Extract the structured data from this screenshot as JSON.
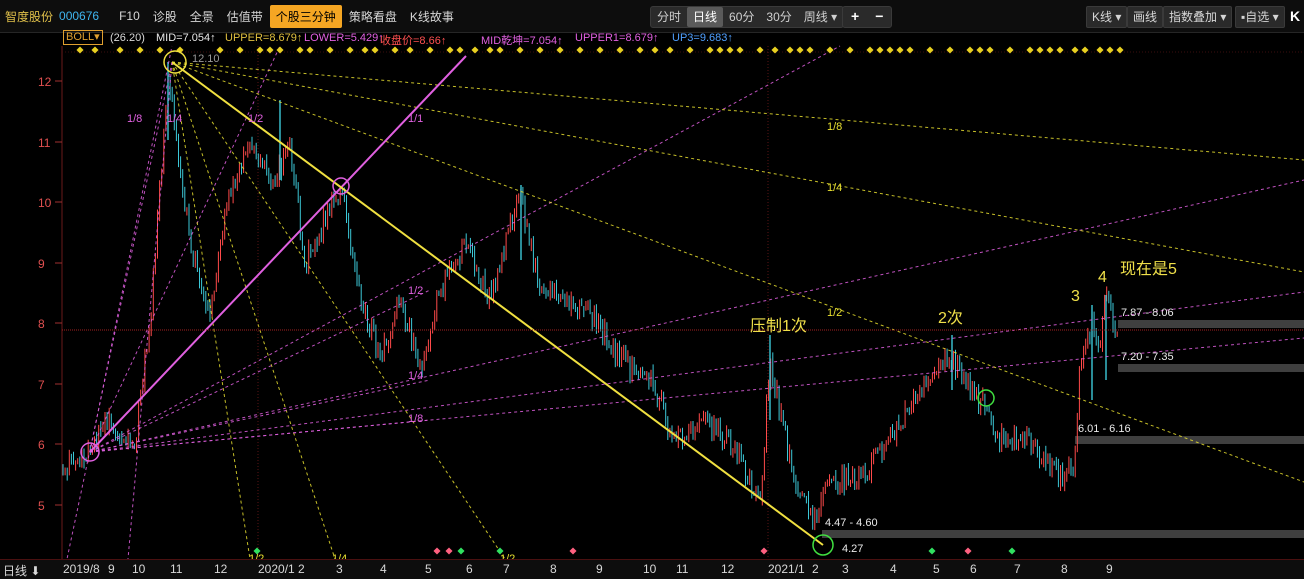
{
  "header": {
    "stock_name": "智度股份",
    "stock_code": "000676",
    "menu": [
      "F10",
      "诊股",
      "全景",
      "估值带",
      "个股三分钟",
      "策略看盘",
      "K线故事"
    ],
    "active_menu": "个股三分钟",
    "periods": [
      "分时",
      "日线",
      "60分",
      "30分",
      "周线 ▾"
    ],
    "active_period": "日线",
    "zoom_in": "+",
    "zoom_out": "−",
    "right_buttons": [
      "K线 ▾",
      "画线",
      "指数叠加 ▾",
      "▪自选 ▾"
    ],
    "right_edge": "K"
  },
  "indicator": {
    "name": "BOLL▾",
    "params": "(26.20)",
    "mid": "MID=7.054↑",
    "upper": "UPPER=8.679↑",
    "lower": "LOWER=5.429↑",
    "close": "收盘价=8.66↑",
    "mid2": "MID乾坤=7.054↑",
    "upper1": "UPPER1=8.679↑",
    "up3": "UP3=9.683↑"
  },
  "y_axis": [
    "12",
    "11",
    "10",
    "9",
    "8",
    "7",
    "6",
    "5"
  ],
  "x_axis": {
    "period_label": "日线 ⬇",
    "labels": [
      "2019/8",
      "9",
      "10",
      "11",
      "12",
      "2020/1",
      "2",
      "3",
      "4",
      "5",
      "6",
      "7",
      "8",
      "9",
      "10",
      "11",
      "12",
      "2021/1",
      "2",
      "3",
      "4",
      "5",
      "6",
      "7",
      "8",
      "9"
    ]
  },
  "annotations": {
    "press1": "压制1次",
    "second": "2次",
    "n3": "3",
    "n4": "4",
    "now5": "现在是5"
  },
  "price_zones": {
    "z1": "7.87 - 8.06",
    "z2": "7.20 - 7.35",
    "z3": "6.01 - 6.16",
    "z4": "4.47 - 4.60",
    "low": "4.27",
    "high_tag": "12.10"
  },
  "fan_labels": {
    "a": "1/8",
    "b": "1/4",
    "c": "1/2",
    "d": "1/1",
    "e": "1/8",
    "f": "1/4",
    "g": "1/2",
    "h": "1/2",
    "i": "1/4",
    "j": "1/8",
    "k": "1/2",
    "l": "1/4",
    "m": "1/2"
  },
  "colors": {
    "up": "#ff4a4a",
    "down": "#3cc8d8",
    "accent": "#f5a623",
    "fan_yellow": "#e8e030",
    "fan_magenta": "#e060e0"
  }
}
